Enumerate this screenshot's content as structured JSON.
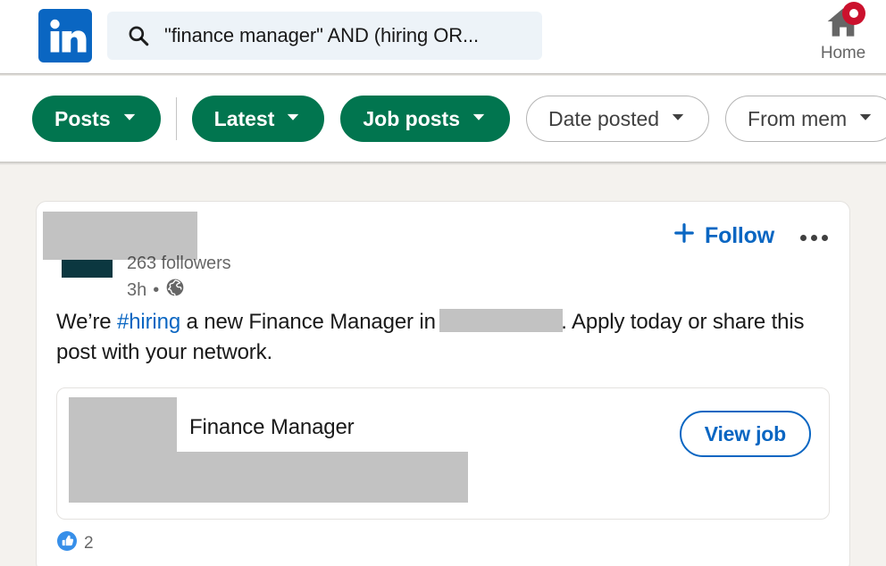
{
  "header": {
    "logo_icon": "linkedin-logo-icon",
    "search": {
      "icon": "search-icon",
      "value": "\"finance manager\" AND (hiring OR...",
      "placeholder": "Search"
    },
    "home": {
      "icon": "home-icon",
      "label": "Home",
      "badge_icon": "notification-badge-icon"
    }
  },
  "filters": {
    "pills": [
      {
        "label": "Posts",
        "selected": true,
        "chevron": "chevron-down-icon"
      },
      {
        "label": "Latest",
        "selected": true,
        "chevron": "chevron-down-icon"
      },
      {
        "label": "Job posts",
        "selected": true,
        "chevron": "chevron-down-icon"
      },
      {
        "label": "Date posted",
        "selected": false,
        "chevron": "chevron-down-icon"
      },
      {
        "label": "From mem",
        "selected": false,
        "chevron": "chevron-down-icon"
      }
    ]
  },
  "post": {
    "followers": "263 followers",
    "age": "3h",
    "separator": "•",
    "visibility_icon": "globe-icon",
    "follow_label": "Follow",
    "follow_icon": "plus-icon",
    "more_icon": "ellipsis-icon",
    "text": {
      "part1": "We’re ",
      "hashtag": "#hiring",
      "part2": " a new Finance Manager in ",
      "part3": ". Apply today or share this post with your network."
    },
    "job_card": {
      "title": "Finance Manager",
      "cta_label": "View job"
    },
    "social": {
      "reaction_icon": "like-icon",
      "count": "2"
    }
  },
  "colors": {
    "brand_blue": "#0a66c2",
    "filter_green": "#01754f",
    "badge_red": "#cb112d",
    "page_bg": "#f4f2ee",
    "redaction": "#c2c2c2",
    "redaction_dark": "#0b3740"
  }
}
